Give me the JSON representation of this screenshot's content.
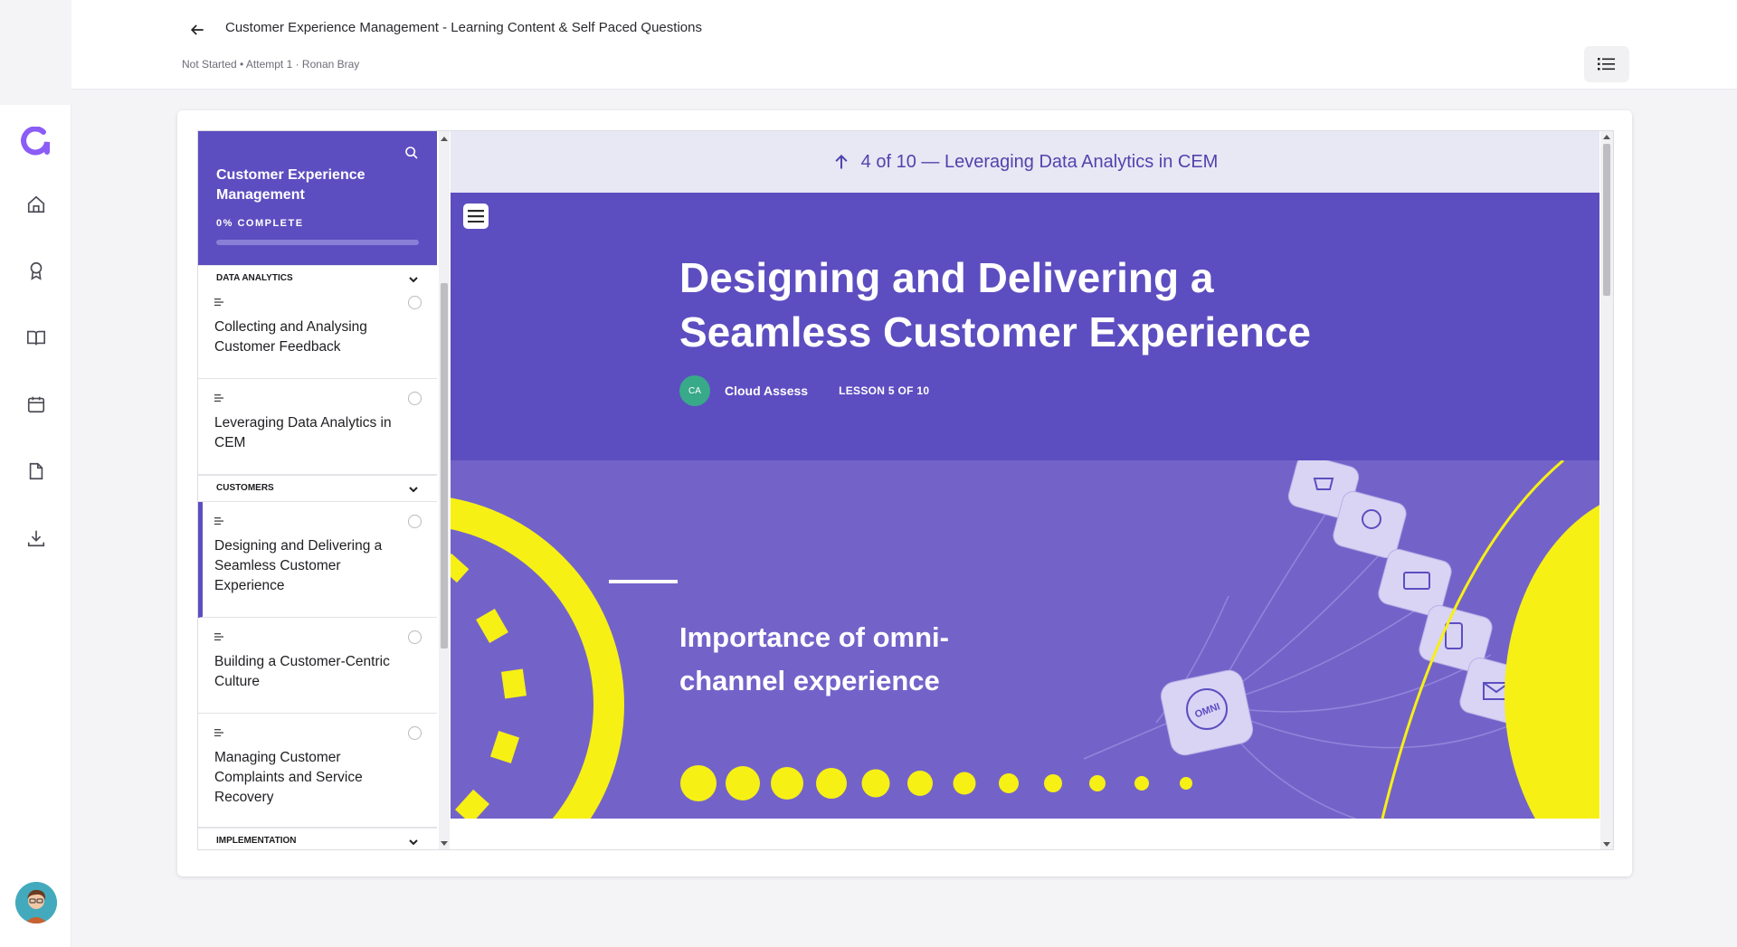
{
  "header": {
    "title": "Customer Experience Management - Learning Content & Self Paced Questions",
    "status_line": "Not Started • Attempt 1 · Ronan Bray"
  },
  "rail": {
    "items": [
      {
        "icon": "home-icon"
      },
      {
        "icon": "award-icon"
      },
      {
        "icon": "book-icon"
      },
      {
        "icon": "calendar-icon"
      },
      {
        "icon": "document-icon"
      },
      {
        "icon": "download-icon"
      }
    ]
  },
  "sidebar": {
    "course_title": "Customer Experience Management",
    "progress_label": "0% COMPLETE",
    "progress": 0,
    "sections": [
      {
        "label": "DATA ANALYTICS"
      },
      {
        "label": "CUSTOMERS"
      },
      {
        "label": "IMPLEMENTATION"
      }
    ],
    "lessons": [
      {
        "label": "Collecting and Analysing Customer Feedback"
      },
      {
        "label": "Leveraging Data Analytics in CEM"
      },
      {
        "label": "Designing and Delivering a Seamless Customer Experience"
      },
      {
        "label": "Building a Customer-Centric Culture"
      },
      {
        "label": "Managing Customer Complaints and Service Recovery"
      }
    ]
  },
  "main": {
    "prev_nav": "4 of 10 — Leveraging Data Analytics in CEM",
    "lesson_title": "Designing and Delivering a Seamless Customer Experience",
    "author_initials": "CA",
    "author": "Cloud Assess",
    "lesson_counter": "LESSON 5 OF 10",
    "banner_heading": "Importance of omni-channel experience",
    "cube_label": "OMNI"
  },
  "colors": {
    "brand": "#5c4ec0",
    "banner": "#7363c9",
    "accent_yellow": "#f7f015",
    "author_badge": "#38a989"
  }
}
